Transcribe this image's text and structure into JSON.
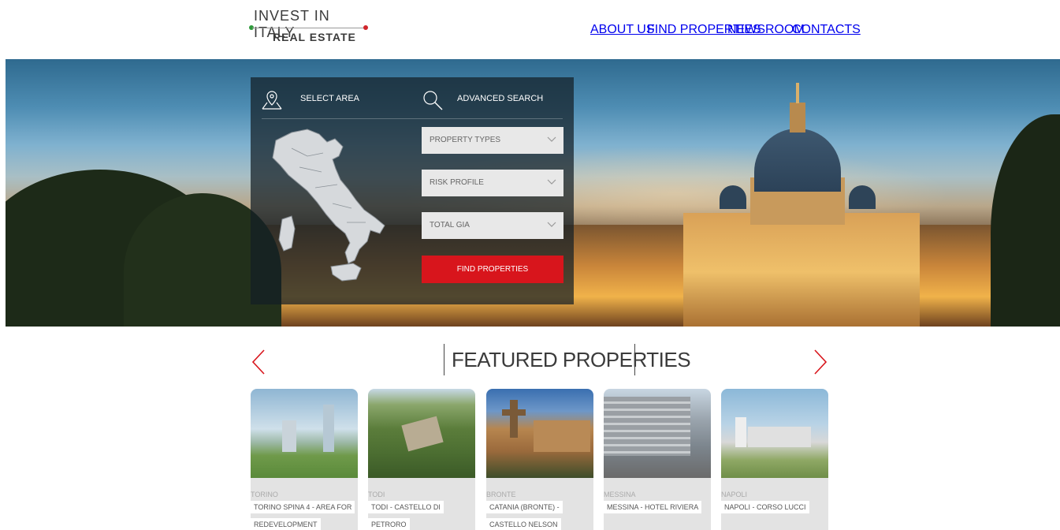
{
  "header": {
    "logo_line1": "INVEST IN ITALY",
    "logo_line2": "REAL ESTATE",
    "nav": [
      "ABOUT US",
      "FIND PROPERTIES",
      "NEWSROOM",
      "CONTACTS"
    ]
  },
  "search": {
    "select_area_label": "SELECT AREA",
    "advanced_search_label": "ADVANCED SEARCH",
    "filters": [
      {
        "label": "PROPERTY TYPES"
      },
      {
        "label": "RISK PROFILE"
      },
      {
        "label": "TOTAL GIA"
      }
    ],
    "button_label": "FIND PROPERTIES"
  },
  "featured": {
    "title": "FEATURED PROPERTIES",
    "cards": [
      {
        "city": "TORINO",
        "title_lines": [
          "TORINO SPINA 4 - AREA FOR",
          "REDEVELOPMENT"
        ]
      },
      {
        "city": "TODI",
        "title_lines": [
          "TODI - CASTELLO DI",
          "PETRORO"
        ]
      },
      {
        "city": "BRONTE",
        "title_lines": [
          "CATANIA (BRONTE) -",
          "CASTELLO NELSON"
        ]
      },
      {
        "city": "MESSINA",
        "title_lines": [
          "MESSINA - HOTEL RIVIERA"
        ]
      },
      {
        "city": "NAPOLI",
        "title_lines": [
          "NAPOLI - CORSO LUCCI"
        ]
      }
    ]
  },
  "colors": {
    "accent_red": "#d8151c",
    "logo_green": "#2e9a3a",
    "logo_red": "#d0262c"
  },
  "icons": [
    "map-pin-icon",
    "search-icon",
    "chevron-down-icon",
    "arrow-left-icon",
    "arrow-right-icon",
    "italy-map"
  ]
}
